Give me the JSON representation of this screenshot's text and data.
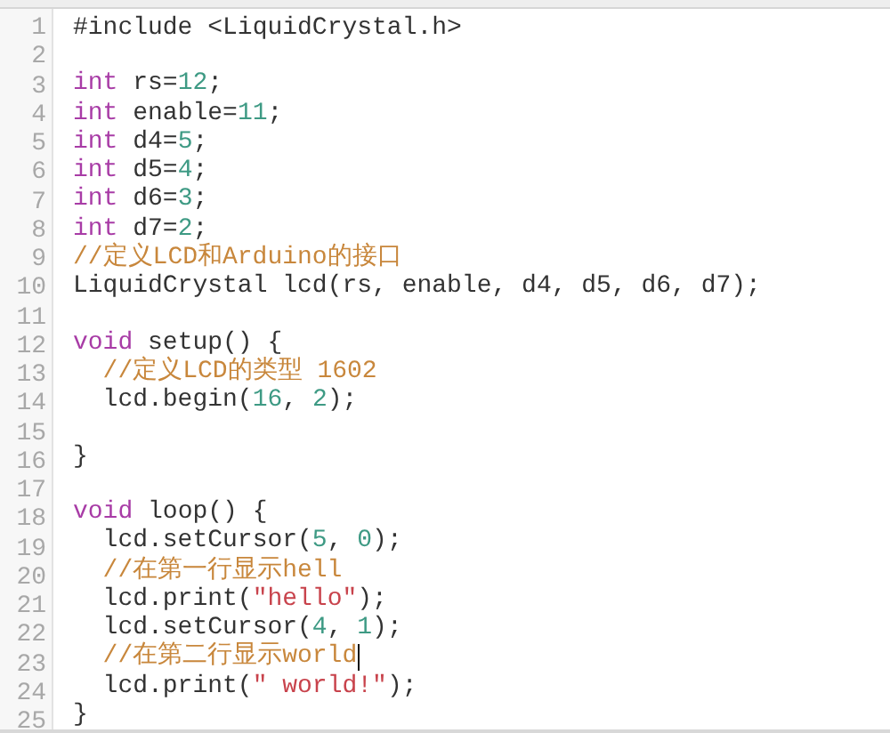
{
  "editor": {
    "lines": [
      {
        "number": "1",
        "tokens": [
          {
            "kind": "plain",
            "text": "#include <LiquidCrystal.h>"
          }
        ],
        "cursor": false
      },
      {
        "number": "2",
        "cursor": false
      },
      {
        "number": "3",
        "tokens": [
          {
            "kind": "keyword",
            "text": "int"
          },
          {
            "kind": "plain",
            "text": " rs="
          },
          {
            "kind": "number",
            "text": "12"
          },
          {
            "kind": "plain",
            "text": ";"
          }
        ],
        "cursor": false
      },
      {
        "number": "4",
        "tokens": [
          {
            "kind": "keyword",
            "text": "int"
          },
          {
            "kind": "plain",
            "text": " enable="
          },
          {
            "kind": "number",
            "text": "11"
          },
          {
            "kind": "plain",
            "text": ";"
          }
        ],
        "cursor": false
      },
      {
        "number": "5",
        "tokens": [
          {
            "kind": "keyword",
            "text": "int"
          },
          {
            "kind": "plain",
            "text": " d4="
          },
          {
            "kind": "number",
            "text": "5"
          },
          {
            "kind": "plain",
            "text": ";"
          }
        ],
        "cursor": false
      },
      {
        "number": "6",
        "tokens": [
          {
            "kind": "keyword",
            "text": "int"
          },
          {
            "kind": "plain",
            "text": " d5="
          },
          {
            "kind": "number",
            "text": "4"
          },
          {
            "kind": "plain",
            "text": ";"
          }
        ],
        "cursor": false
      },
      {
        "number": "7",
        "tokens": [
          {
            "kind": "keyword",
            "text": "int"
          },
          {
            "kind": "plain",
            "text": " d6="
          },
          {
            "kind": "number",
            "text": "3"
          },
          {
            "kind": "plain",
            "text": ";"
          }
        ],
        "cursor": false
      },
      {
        "number": "8",
        "tokens": [
          {
            "kind": "keyword",
            "text": "int"
          },
          {
            "kind": "plain",
            "text": " d7="
          },
          {
            "kind": "number",
            "text": "2"
          },
          {
            "kind": "plain",
            "text": ";"
          }
        ],
        "cursor": false
      },
      {
        "number": "9",
        "tokens": [
          {
            "kind": "comment",
            "text": "//定义LCD和Arduino的接口"
          }
        ],
        "cursor": false
      },
      {
        "number": "10",
        "tokens": [
          {
            "kind": "plain",
            "text": "LiquidCrystal lcd(rs, enable, d4, d5, d6, d7);"
          }
        ],
        "cursor": false
      },
      {
        "number": "11",
        "cursor": false
      },
      {
        "number": "12",
        "tokens": [
          {
            "kind": "keyword",
            "text": "void"
          },
          {
            "kind": "plain",
            "text": " setup() {"
          }
        ],
        "cursor": false
      },
      {
        "number": "13",
        "tokens": [
          {
            "kind": "comment",
            "text": "  //定义LCD的类型 1602"
          }
        ],
        "cursor": false
      },
      {
        "number": "14",
        "tokens": [
          {
            "kind": "plain",
            "text": "  lcd.begin("
          },
          {
            "kind": "number",
            "text": "16"
          },
          {
            "kind": "plain",
            "text": ", "
          },
          {
            "kind": "number",
            "text": "2"
          },
          {
            "kind": "plain",
            "text": ");"
          }
        ],
        "cursor": false
      },
      {
        "number": "15",
        "cursor": false
      },
      {
        "number": "16",
        "tokens": [
          {
            "kind": "plain",
            "text": "}"
          }
        ],
        "cursor": false
      },
      {
        "number": "17",
        "cursor": false
      },
      {
        "number": "18",
        "tokens": [
          {
            "kind": "keyword",
            "text": "void"
          },
          {
            "kind": "plain",
            "text": " loop() {"
          }
        ],
        "cursor": false
      },
      {
        "number": "19",
        "tokens": [
          {
            "kind": "plain",
            "text": "  lcd.setCursor("
          },
          {
            "kind": "number",
            "text": "5"
          },
          {
            "kind": "plain",
            "text": ", "
          },
          {
            "kind": "number",
            "text": "0"
          },
          {
            "kind": "plain",
            "text": ");"
          }
        ],
        "cursor": false
      },
      {
        "number": "20",
        "tokens": [
          {
            "kind": "comment",
            "text": "  //在第一行显示hell"
          }
        ],
        "cursor": false
      },
      {
        "number": "21",
        "tokens": [
          {
            "kind": "plain",
            "text": "  lcd.print("
          },
          {
            "kind": "string",
            "text": "\"hello\""
          },
          {
            "kind": "plain",
            "text": ");"
          }
        ],
        "cursor": false
      },
      {
        "number": "22",
        "tokens": [
          {
            "kind": "plain",
            "text": "  lcd.setCursor("
          },
          {
            "kind": "number",
            "text": "4"
          },
          {
            "kind": "plain",
            "text": ", "
          },
          {
            "kind": "number",
            "text": "1"
          },
          {
            "kind": "plain",
            "text": ");"
          }
        ],
        "cursor": false
      },
      {
        "number": "23",
        "tokens": [
          {
            "kind": "comment",
            "text": "  //在第二行显示world"
          }
        ],
        "cursor": true
      },
      {
        "number": "24",
        "tokens": [
          {
            "kind": "plain",
            "text": "  lcd.print("
          },
          {
            "kind": "string",
            "text": "\" world!\""
          },
          {
            "kind": "plain",
            "text": ");"
          }
        ],
        "cursor": false
      },
      {
        "number": "25",
        "tokens": [
          {
            "kind": "plain",
            "text": "}"
          }
        ],
        "cursor": false
      }
    ]
  }
}
